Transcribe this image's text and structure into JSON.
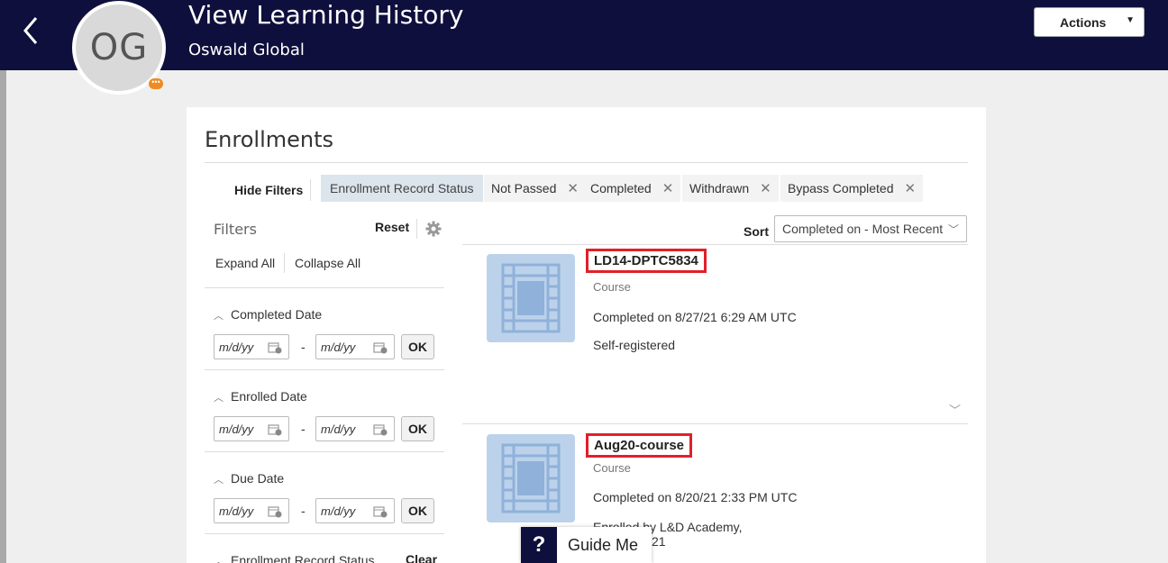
{
  "header": {
    "title": "View Learning History",
    "subtitle": "Oswald Global",
    "avatar_initials": "OG",
    "avatar_badge": "•••",
    "actions_label": "Actions",
    "actions_caret": "▼",
    "background_color": "#0f0f3d"
  },
  "enrollments": {
    "section_title": "Enrollments",
    "hide_filters_label": "Hide Filters",
    "active_filter_label": "Enrollment Record Status",
    "active_filter_chips": [
      "Not Passed",
      "Completed",
      "Withdrawn",
      "Bypass Completed"
    ],
    "chip_remove_glyph": "✕"
  },
  "filters": {
    "title": "Filters",
    "reset_label": "Reset",
    "settings_icon": "gear-icon",
    "expand_all_label": "Expand All",
    "collapse_all_label": "Collapse All",
    "sections": [
      {
        "label": "Completed Date",
        "from_placeholder": "m/d/yy",
        "to_placeholder": "m/d/yy",
        "ok_label": "OK"
      },
      {
        "label": "Enrolled Date",
        "from_placeholder": "m/d/yy",
        "to_placeholder": "m/d/yy",
        "ok_label": "OK"
      },
      {
        "label": "Due Date",
        "from_placeholder": "m/d/yy",
        "to_placeholder": "m/d/yy",
        "ok_label": "OK"
      }
    ],
    "range_separator": "-",
    "next_section_label": "Enrollment Record Status",
    "clear_label": "Clear"
  },
  "sort": {
    "label": "Sort",
    "selected_value": "Completed on - Most Recent"
  },
  "results": [
    {
      "title": "LD14-DPTC5834",
      "type": "Course",
      "completed": "Completed on 8/27/21 6:29 AM UTC",
      "registration": "Self-registered"
    },
    {
      "title": "Aug20-course",
      "type": "Course",
      "completed": "Completed on 8/20/21 2:33 PM UTC",
      "registration": "Enrolled by L&D Academy,"
    }
  ],
  "guide_me": {
    "icon": "?",
    "label": "Guide Me",
    "overflow_text": "21"
  }
}
